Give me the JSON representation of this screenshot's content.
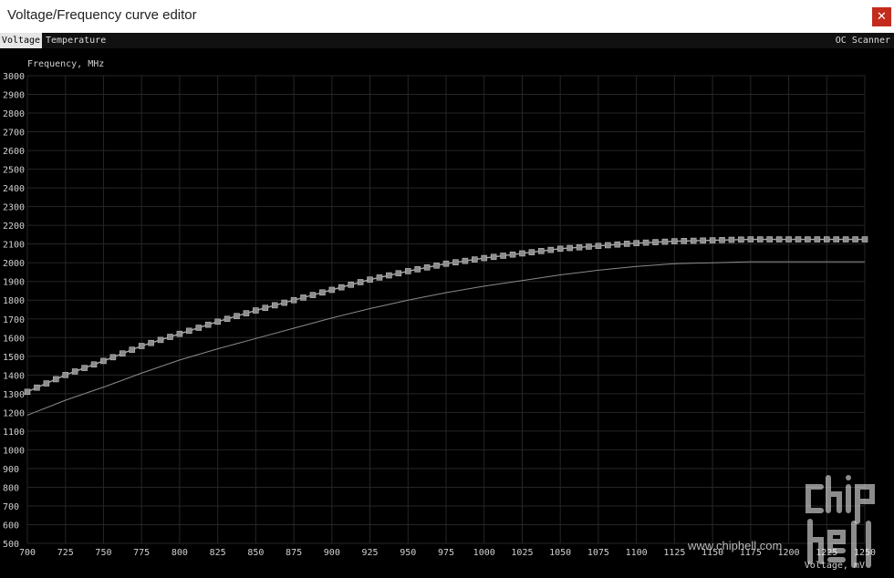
{
  "window": {
    "title": "Voltage/Frequency curve editor",
    "close_glyph": "✕"
  },
  "tabs": [
    {
      "label": "Voltage",
      "active": true
    },
    {
      "label": "Temperature",
      "active": false
    }
  ],
  "oc_scanner_label": "OC Scanner",
  "watermark": {
    "url": "www.chiphell.com"
  },
  "chart_data": {
    "type": "line",
    "ylabel": "Frequency, MHz",
    "xlabel": "Voltage, mV",
    "xlim": [
      700,
      1250
    ],
    "ylim": [
      500,
      3000
    ],
    "grid": true,
    "x_ticks": [
      "700",
      "725",
      "750",
      "775",
      "800",
      "825",
      "850",
      "875",
      "900",
      "925",
      "950",
      "975",
      "1000",
      "1025",
      "1050",
      "1075",
      "1100",
      "1125",
      "1150",
      "1175",
      "1200",
      "1225",
      "1250"
    ],
    "y_ticks": [
      "500",
      "600",
      "700",
      "800",
      "900",
      "1000",
      "1100",
      "1200",
      "1300",
      "1400",
      "1500",
      "1600",
      "1700",
      "1800",
      "1900",
      "2000",
      "2100",
      "2200",
      "2300",
      "2400",
      "2500",
      "2600",
      "2700",
      "2800",
      "2900",
      "3000"
    ],
    "series": [
      {
        "role": "edited-curve",
        "color": "#a8a8a8",
        "x": [
          700,
          725,
          750,
          775,
          800,
          825,
          850,
          875,
          900,
          925,
          950,
          975,
          1000,
          1025,
          1050,
          1075,
          1100,
          1125,
          1150,
          1175,
          1200,
          1225,
          1250
        ],
        "y": [
          1310,
          1400,
          1475,
          1555,
          1620,
          1685,
          1745,
          1800,
          1855,
          1910,
          1955,
          1995,
          2025,
          2050,
          2075,
          2090,
          2105,
          2115,
          2120,
          2125,
          2125,
          2125,
          2125
        ]
      },
      {
        "role": "default-curve",
        "color": "#8a8a8a",
        "x": [
          700,
          725,
          750,
          775,
          800,
          825,
          850,
          875,
          900,
          925,
          950,
          975,
          1000,
          1025,
          1050,
          1075,
          1100,
          1125,
          1150,
          1175,
          1200,
          1225,
          1250
        ],
        "y": [
          1185,
          1265,
          1335,
          1410,
          1480,
          1540,
          1595,
          1650,
          1705,
          1755,
          1800,
          1840,
          1875,
          1905,
          1935,
          1960,
          1980,
          1995,
          2000,
          2005,
          2005,
          2005,
          2005
        ]
      }
    ]
  }
}
